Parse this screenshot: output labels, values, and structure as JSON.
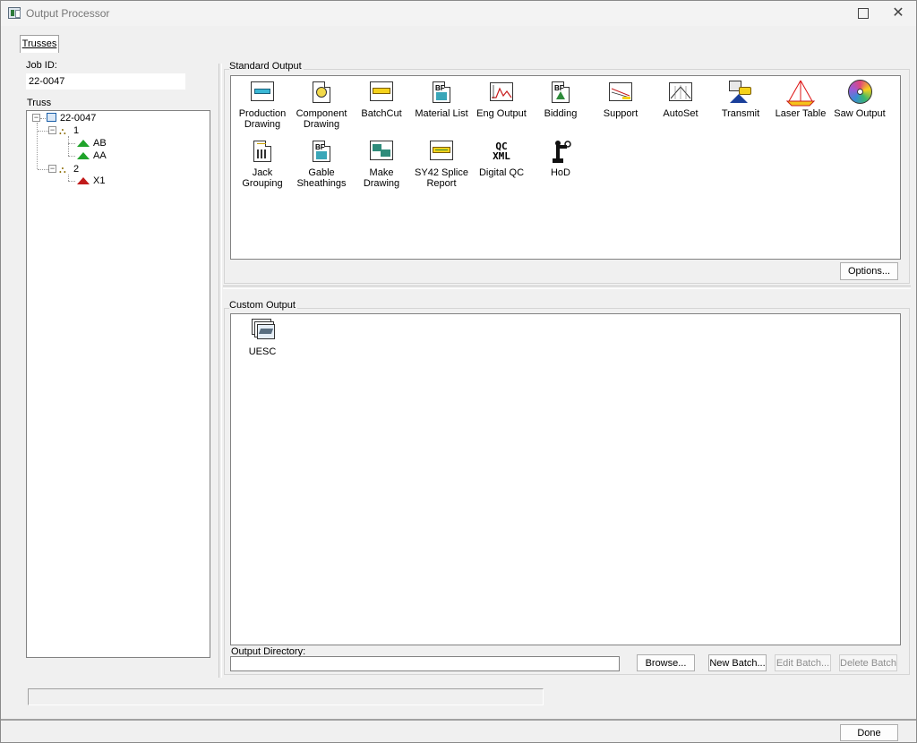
{
  "window": {
    "title": "Output Processor",
    "tab_label": "Trusses"
  },
  "job": {
    "label": "Job ID:",
    "value": "22-0047"
  },
  "tree": {
    "label": "Truss",
    "root": "22-0047",
    "groups": [
      {
        "label": "1",
        "children": [
          "AB",
          "AA"
        ]
      },
      {
        "label": "2",
        "children": [
          "X1"
        ]
      }
    ]
  },
  "standard_output": {
    "title": "Standard Output",
    "items": [
      {
        "label": "Production Drawing",
        "icon": "production-drawing-icon"
      },
      {
        "label": "Component Drawing",
        "icon": "component-drawing-icon"
      },
      {
        "label": "BatchCut",
        "icon": "batchcut-icon"
      },
      {
        "label": "Material List",
        "icon": "material-list-icon"
      },
      {
        "label": "Eng Output",
        "icon": "eng-output-icon"
      },
      {
        "label": "Bidding",
        "icon": "bidding-icon"
      },
      {
        "label": "Support",
        "icon": "support-icon"
      },
      {
        "label": "AutoSet",
        "icon": "autoset-icon"
      },
      {
        "label": "Transmit",
        "icon": "transmit-icon"
      },
      {
        "label": "Laser Table",
        "icon": "laser-table-icon"
      },
      {
        "label": "Saw Output",
        "icon": "saw-output-icon"
      },
      {
        "label": "Jack Grouping",
        "icon": "jack-grouping-icon"
      },
      {
        "label": "Gable Sheathings",
        "icon": "gable-sheathings-icon"
      },
      {
        "label": "Make Drawing",
        "icon": "make-drawing-icon"
      },
      {
        "label": "SY42 Splice Report",
        "icon": "sy42-splice-report-icon"
      },
      {
        "label": "Digital QC",
        "icon": "digital-qc-icon",
        "icon_text_1": "QC",
        "icon_text_2": "XML"
      },
      {
        "label": "HoD",
        "icon": "hod-icon"
      }
    ],
    "options_button": "Options..."
  },
  "custom_output": {
    "title": "Custom Output",
    "items": [
      {
        "label": "UESC",
        "icon": "uesc-icon"
      }
    ]
  },
  "output_directory": {
    "label": "Output Directory:",
    "value": ""
  },
  "buttons": {
    "browse": "Browse...",
    "new_batch": "New Batch...",
    "edit_batch": "Edit Batch...",
    "delete_batch": "Delete Batch",
    "done": "Done"
  },
  "status": {
    "text": ""
  },
  "colors": {
    "window_bg": "#f0f0f0",
    "truss_ok": "#1fa32a",
    "truss_error": "#c11a1a"
  }
}
